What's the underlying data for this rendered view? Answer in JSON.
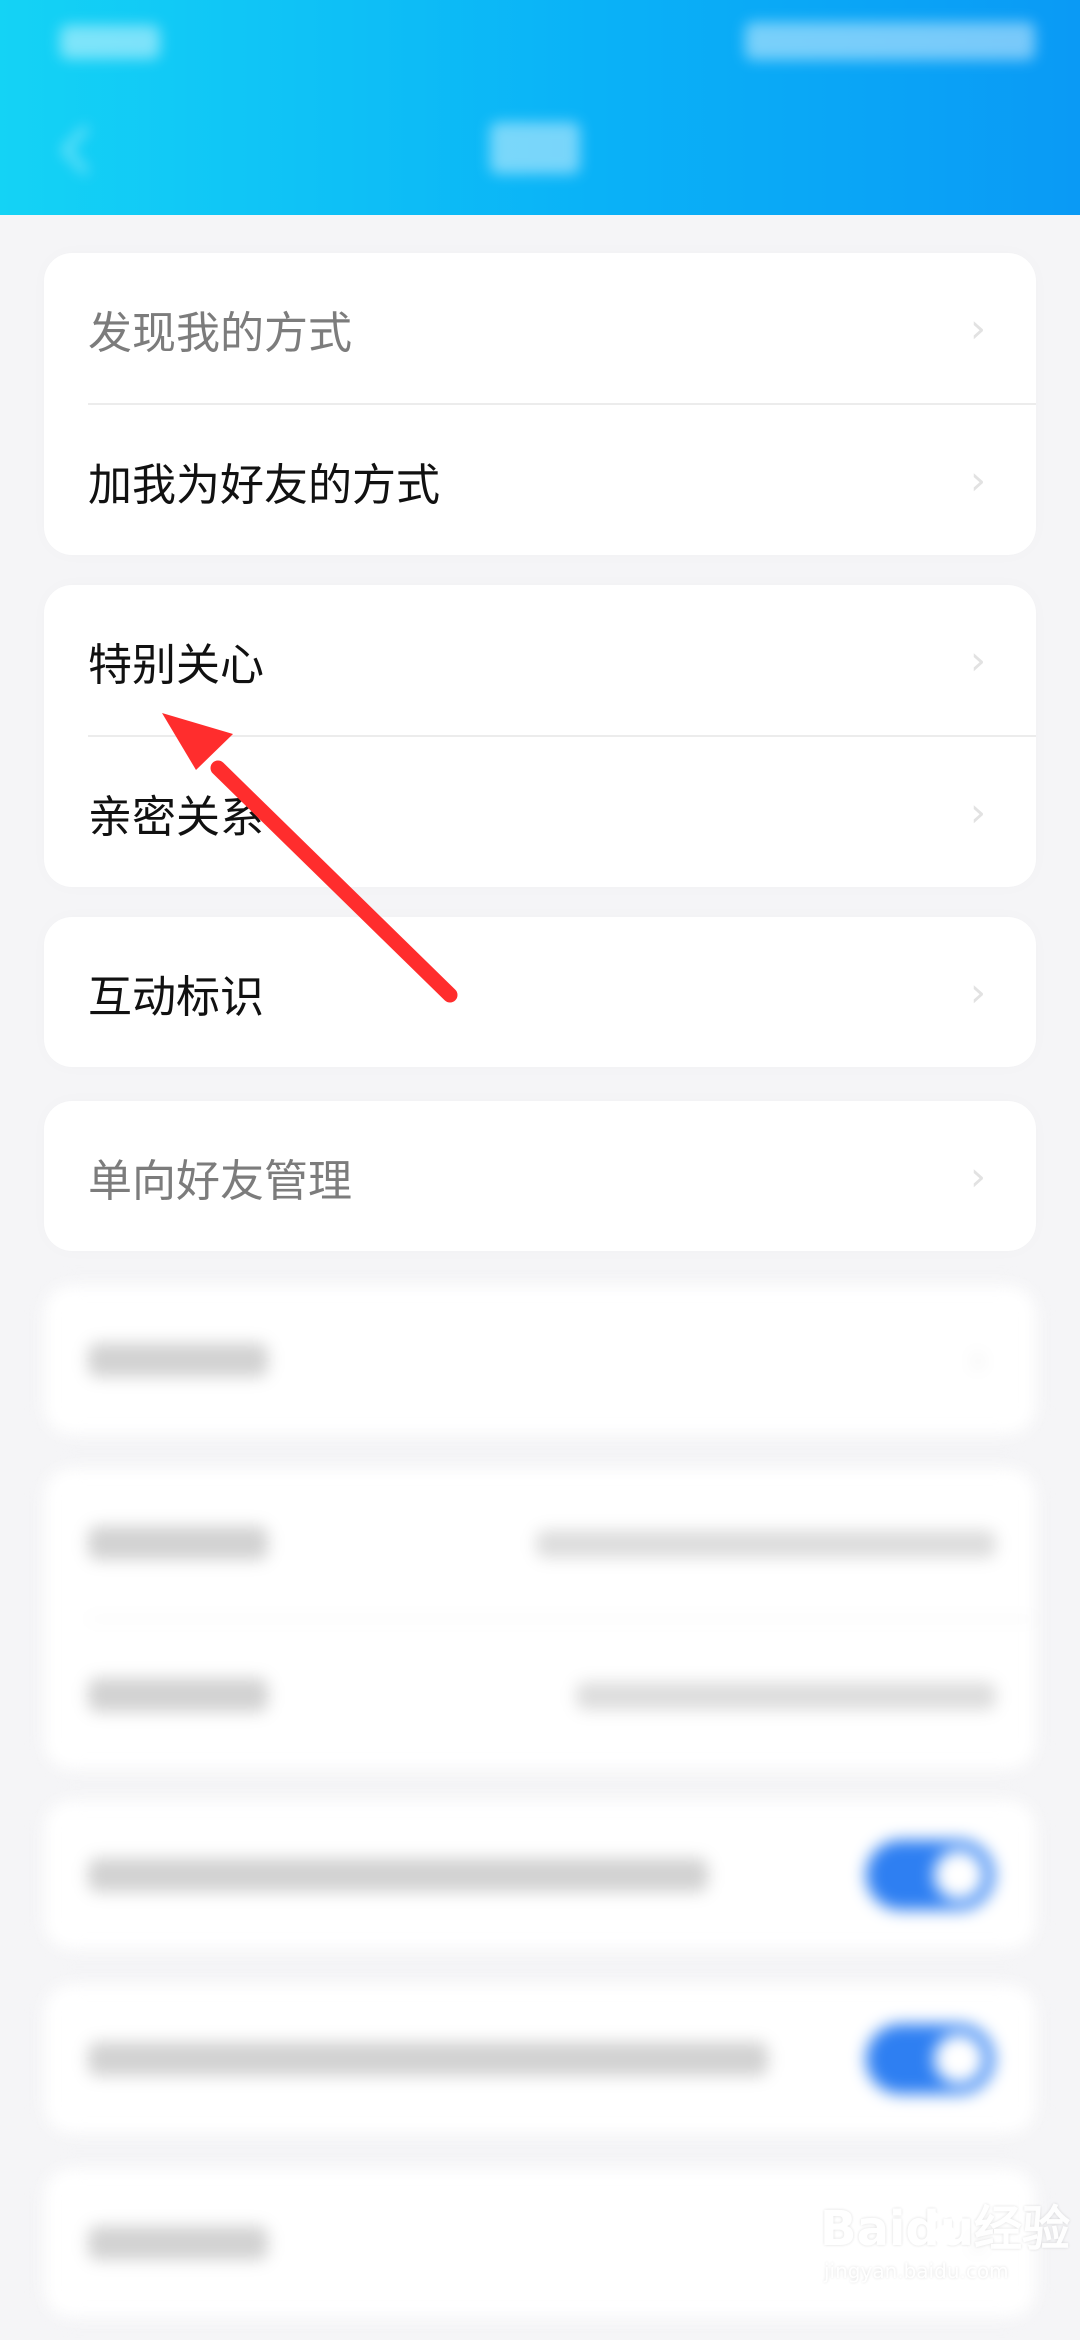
{
  "header": {
    "back_icon": "chevron-left-icon",
    "status_bar": "blurred",
    "title": "blurred"
  },
  "settings": {
    "group1": [
      {
        "label": "发现我的方式"
      },
      {
        "label": "加我为好友的方式"
      }
    ],
    "group2": [
      {
        "label": "特别关心"
      },
      {
        "label": "亲密关系"
      }
    ],
    "group3": [
      {
        "label": "互动标识"
      }
    ],
    "group4": [
      {
        "label": "单向好友管理"
      }
    ]
  },
  "annotation": {
    "arrow_color": "#ff2d2d",
    "target": "特别关心"
  },
  "watermark": {
    "brand": "Baidu经验",
    "site": "jingyan.baidu.com"
  }
}
